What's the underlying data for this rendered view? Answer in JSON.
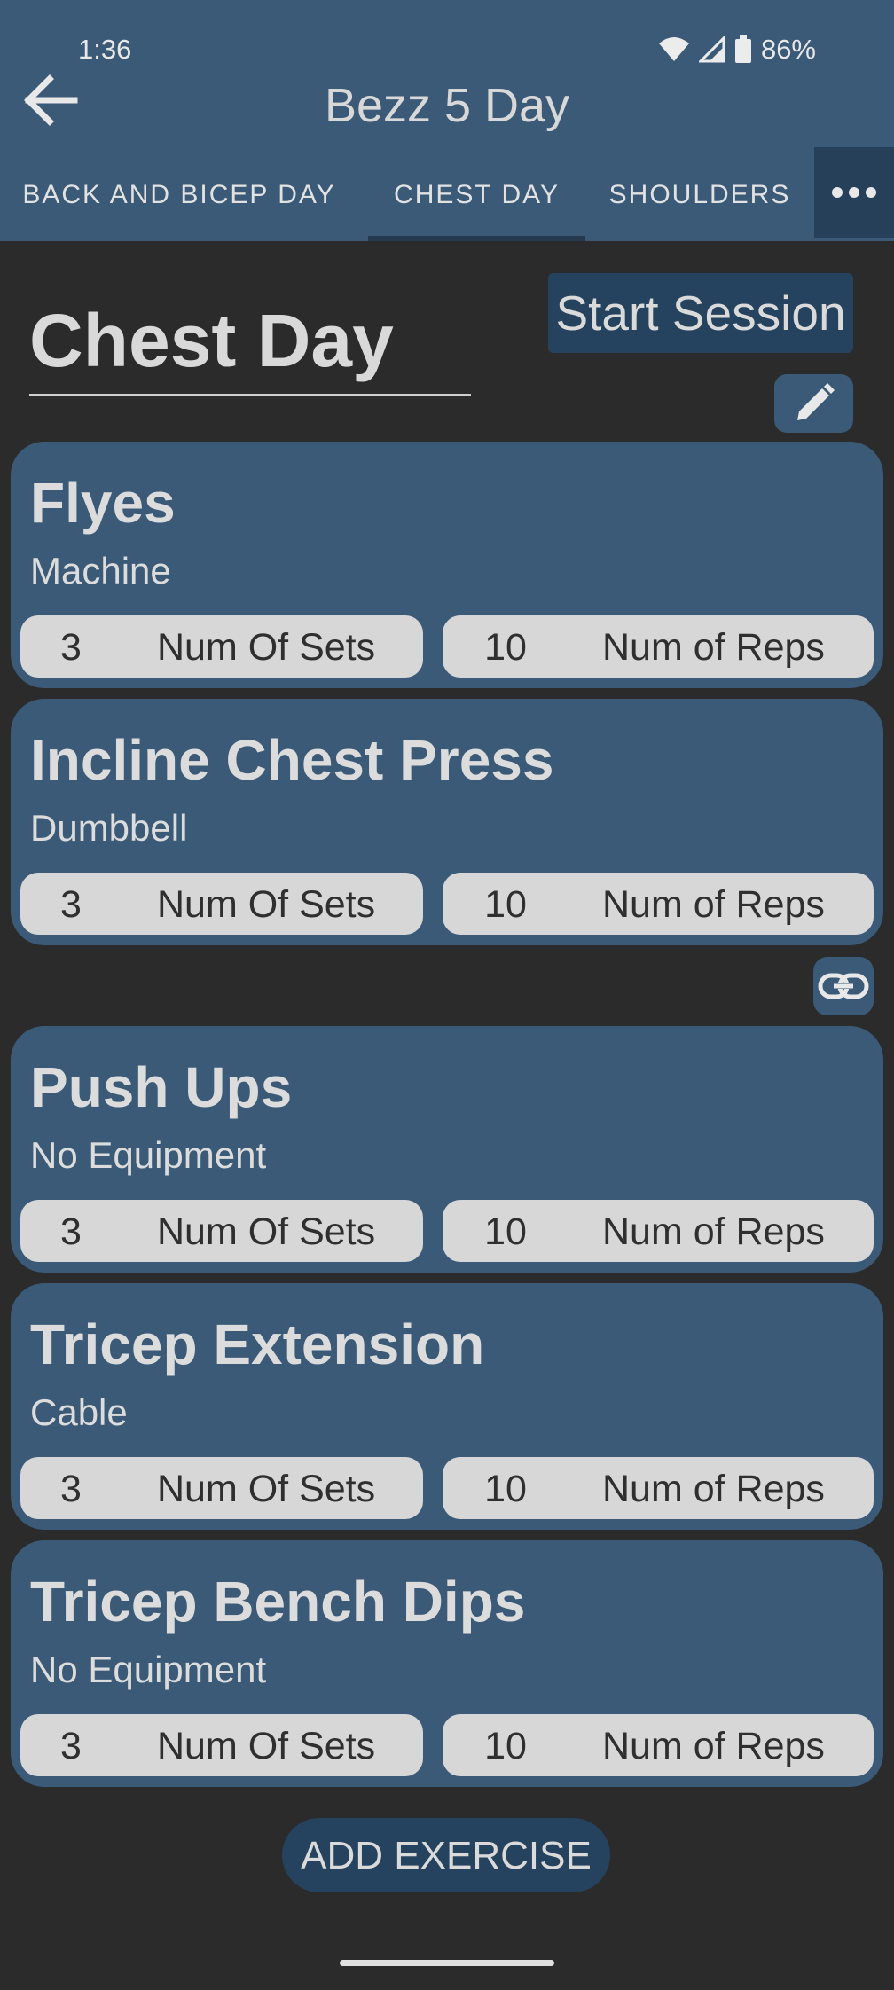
{
  "status": {
    "time": "1:36",
    "battery": "86%"
  },
  "header": {
    "title": "Bezz 5 Day"
  },
  "tabs": [
    {
      "label": "BACK AND BICEP DAY"
    },
    {
      "label": "CHEST DAY"
    },
    {
      "label": "SHOULDERS"
    }
  ],
  "day": {
    "title": "Chest Day",
    "start_label": "Start Session"
  },
  "exercises": [
    {
      "name": "Flyes",
      "equipment": "Machine",
      "sets": "3",
      "sets_label": "Num Of Sets",
      "reps": "10",
      "reps_label": "Num of Reps"
    },
    {
      "name": "Incline Chest Press",
      "equipment": "Dumbbell",
      "sets": "3",
      "sets_label": "Num Of Sets",
      "reps": "10",
      "reps_label": "Num of Reps"
    },
    {
      "name": "Push Ups",
      "equipment": "No Equipment",
      "sets": "3",
      "sets_label": "Num Of Sets",
      "reps": "10",
      "reps_label": "Num of Reps"
    },
    {
      "name": "Tricep Extension",
      "equipment": "Cable",
      "sets": "3",
      "sets_label": "Num Of Sets",
      "reps": "10",
      "reps_label": "Num of Reps"
    },
    {
      "name": "Tricep Bench Dips",
      "equipment": "No Equipment",
      "sets": "3",
      "sets_label": "Num Of Sets",
      "reps": "10",
      "reps_label": "Num of Reps"
    }
  ],
  "add_exercise_label": "ADD EXERCISE",
  "icons": {
    "back": "arrow-left-icon",
    "more": "more-dots-icon",
    "edit": "pencil-icon",
    "link": "link-icon",
    "wifi": "wifi-icon",
    "signal": "signal-icon",
    "battery": "battery-icon"
  },
  "colors": {
    "header": "#3a5a78",
    "background": "#2b2b2b",
    "button_dark": "#25425e",
    "pill": "#d7d7d7"
  }
}
